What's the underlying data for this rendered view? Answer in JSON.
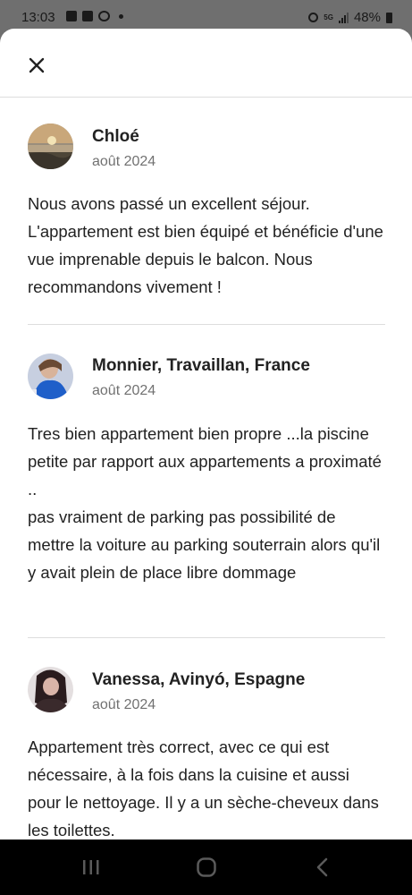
{
  "status_bar": {
    "time": "13:03",
    "battery": "48%",
    "network": "5G",
    "left_icons": [
      "gallery-icon",
      "gallery-icon",
      "message-bubble-icon",
      "dot-icon"
    ],
    "right_icons": [
      "alarm-icon",
      "5g-icon",
      "signal-icon",
      "battery-icon"
    ]
  },
  "header": {
    "close_icon": "close-icon"
  },
  "reviews": [
    {
      "name": "Chloé",
      "date": "août 2024",
      "text": "Nous avons passé un excellent séjour. L'appartement est bien équipé et bénéficie d'une vue imprenable depuis le balcon. Nous recommandons vivement !"
    },
    {
      "name": "Monnier, Travaillan, France",
      "date": "août 2024",
      "text": "Tres bien appartement bien propre ...la piscine petite par rapport aux appartements a proximaté ..\npas vraiment de parking pas possibilité de mettre la voiture au parking souterrain alors qu'il y avait plein de place libre dommage"
    },
    {
      "name": "Vanessa, Avinyó, Espagne",
      "date": "août 2024",
      "text": "Appartement très correct, avec ce qui est nécessaire, à la fois dans la cuisine et aussi pour le nettoyage. Il y a un sèche-cheveux dans les toilettes."
    }
  ],
  "nav_bar": {
    "icons": [
      "recent-apps-icon",
      "home-icon",
      "back-icon"
    ]
  },
  "colors": {
    "status_bar_bg": "#6f6f6f",
    "sheet_bg": "#ffffff",
    "text_primary": "#222222",
    "text_secondary": "#717171",
    "divider": "#dddddd",
    "nav_bar_bg": "#000000"
  }
}
